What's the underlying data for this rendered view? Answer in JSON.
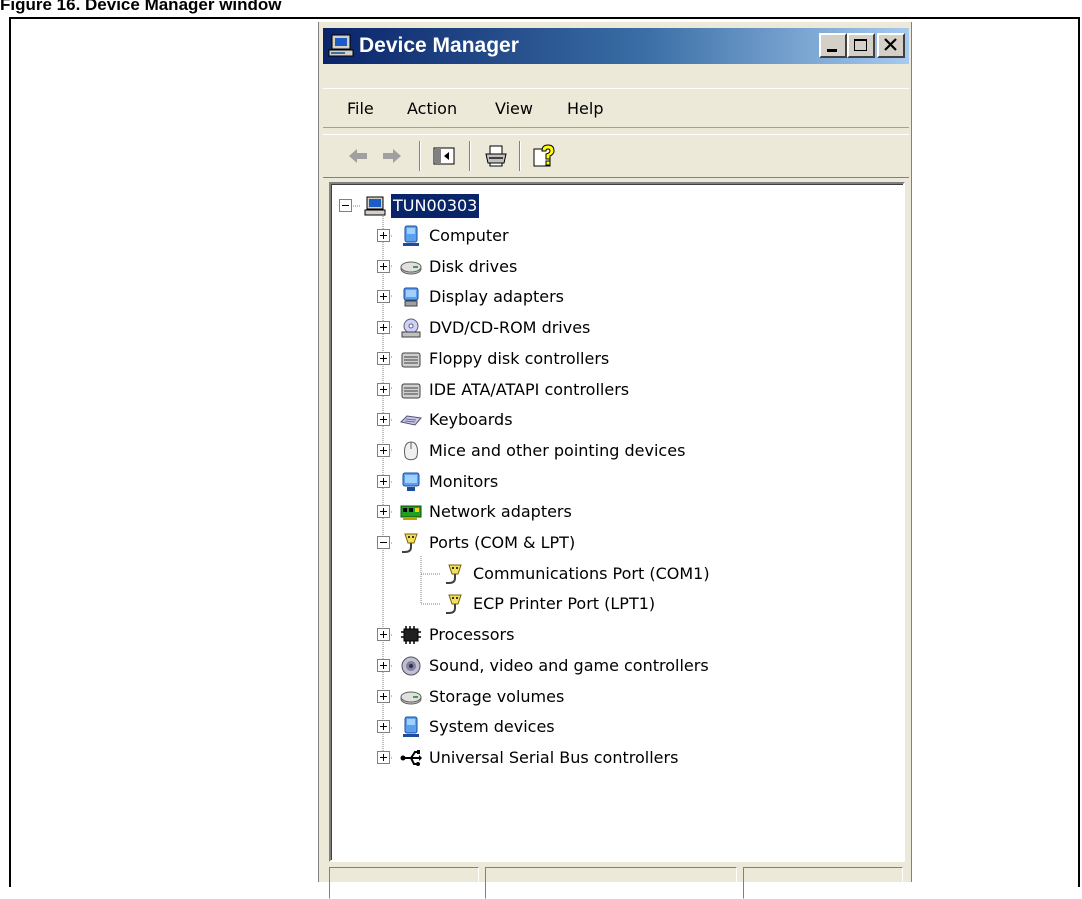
{
  "figure": {
    "caption": "Figure 16. Device Manager window"
  },
  "window": {
    "title": "Device Manager",
    "controls": {
      "minimize": "minimize",
      "maximize": "maximize",
      "close": "close"
    }
  },
  "menu": [
    "File",
    "Action",
    "View",
    "Help"
  ],
  "toolbar": {
    "buttons": [
      "back-arrow-icon",
      "forward-arrow-icon",
      "show-hide-tree-icon",
      "print-icon",
      "help-icon"
    ]
  },
  "tree": {
    "root": {
      "label": "TUN00303",
      "icon": "computer-icon",
      "expanded": true,
      "selected": true
    },
    "items": [
      {
        "label": "Computer",
        "icon": "computer-icon",
        "expanded": false
      },
      {
        "label": "Disk drives",
        "icon": "disk-drive-icon",
        "expanded": false
      },
      {
        "label": "Display adapters",
        "icon": "display-adapter-icon",
        "expanded": false
      },
      {
        "label": "DVD/CD-ROM drives",
        "icon": "cdrom-icon",
        "expanded": false
      },
      {
        "label": "Floppy disk controllers",
        "icon": "controller-icon",
        "expanded": false
      },
      {
        "label": "IDE ATA/ATAPI controllers",
        "icon": "controller-icon",
        "expanded": false
      },
      {
        "label": "Keyboards",
        "icon": "keyboard-icon",
        "expanded": false
      },
      {
        "label": "Mice and other pointing devices",
        "icon": "mouse-icon",
        "expanded": false
      },
      {
        "label": "Monitors",
        "icon": "monitor-icon",
        "expanded": false
      },
      {
        "label": "Network adapters",
        "icon": "network-adapter-icon",
        "expanded": false
      },
      {
        "label": "Ports (COM & LPT)",
        "icon": "port-icon",
        "expanded": true,
        "children": [
          {
            "label": "Communications Port (COM1)",
            "icon": "port-icon"
          },
          {
            "label": "ECP Printer Port (LPT1)",
            "icon": "port-icon"
          }
        ]
      },
      {
        "label": "Processors",
        "icon": "processor-icon",
        "expanded": false
      },
      {
        "label": "Sound, video and game controllers",
        "icon": "sound-icon",
        "expanded": false
      },
      {
        "label": "Storage volumes",
        "icon": "disk-drive-icon",
        "expanded": false
      },
      {
        "label": "System devices",
        "icon": "computer-icon",
        "expanded": false
      },
      {
        "label": "Universal Serial Bus controllers",
        "icon": "usb-icon",
        "expanded": false
      }
    ]
  },
  "statusbar": {
    "panes": [
      "",
      "",
      ""
    ]
  }
}
